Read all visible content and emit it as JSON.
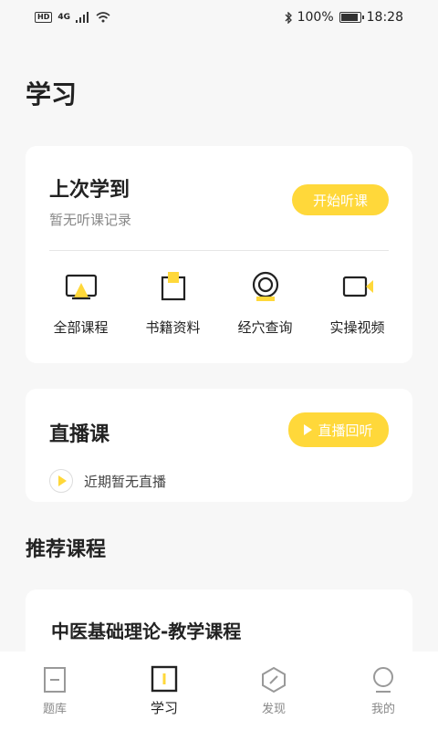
{
  "status": {
    "network": "4G",
    "battery": "100%",
    "time": "18:28"
  },
  "page_title": "学习",
  "recent": {
    "title": "上次学到",
    "subtitle": "暂无听课记录",
    "start_label": "开始听课"
  },
  "features": [
    {
      "label": "全部课程",
      "icon": "monitor-icon"
    },
    {
      "label": "书籍资料",
      "icon": "book-icon"
    },
    {
      "label": "经穴查询",
      "icon": "search-target-icon"
    },
    {
      "label": "实操视频",
      "icon": "video-camera-icon"
    }
  ],
  "live": {
    "title": "直播课",
    "replay_label": "直播回听",
    "empty_text": "近期暂无直播"
  },
  "recommended": {
    "section_title": "推荐课程",
    "course_title": "中医基础理论-教学课程"
  },
  "nav": [
    {
      "label": "题库",
      "icon": "question-bank-icon",
      "active": false
    },
    {
      "label": "学习",
      "icon": "study-icon",
      "active": true
    },
    {
      "label": "发现",
      "icon": "discover-icon",
      "active": false
    },
    {
      "label": "我的",
      "icon": "profile-icon",
      "active": false
    }
  ],
  "colors": {
    "accent": "#ffd83a",
    "background": "#f7f7f7"
  }
}
